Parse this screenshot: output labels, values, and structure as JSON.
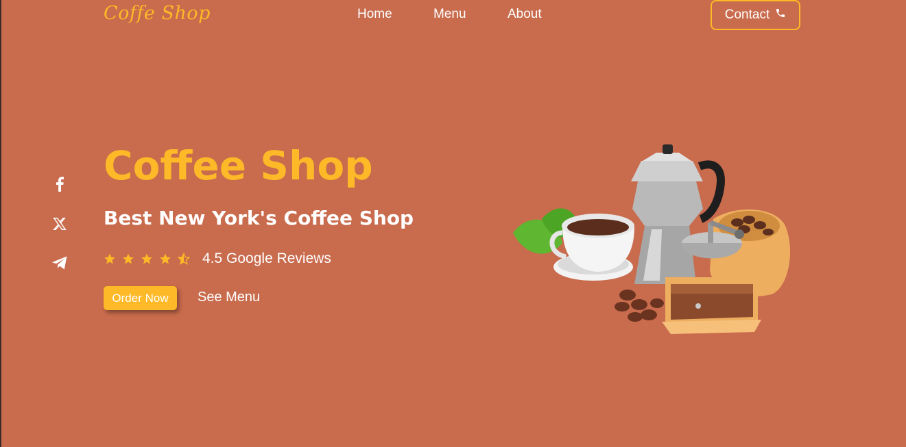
{
  "header": {
    "logo": "Coffe Shop",
    "nav": [
      {
        "label": "Home"
      },
      {
        "label": "Menu"
      },
      {
        "label": "About"
      }
    ],
    "contact_label": "Contact",
    "contact_icon": "phone-icon"
  },
  "social": [
    {
      "icon": "facebook-icon"
    },
    {
      "icon": "x-twitter-icon"
    },
    {
      "icon": "telegram-icon"
    }
  ],
  "hero": {
    "title": "Coffee Shop",
    "subtitle": "Best New York's Coffee Shop",
    "rating_value": 4.5,
    "rating_max": 5,
    "rating_text": "4.5 Google Reviews",
    "order_label": "Order Now",
    "see_menu_label": "See Menu",
    "illustration": "coffee-set-illustration"
  },
  "colors": {
    "background": "#C96B4D",
    "accent": "#FDB927",
    "text": "#FFFFFF"
  }
}
